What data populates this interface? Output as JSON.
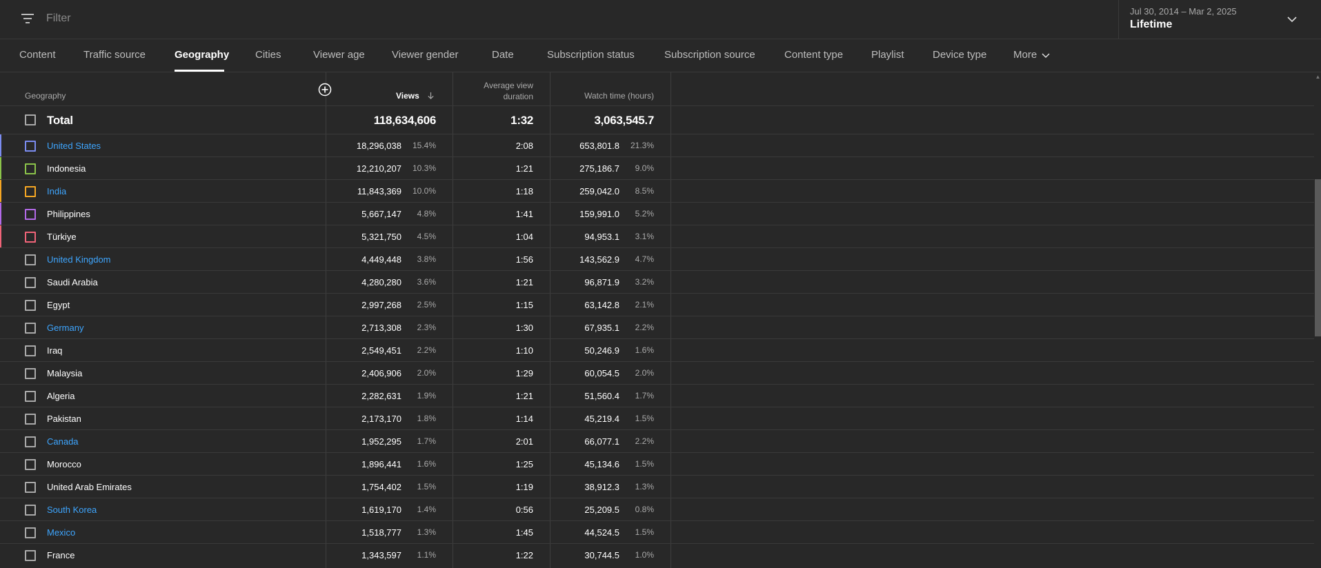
{
  "filter": {
    "placeholder": "Filter"
  },
  "date": {
    "range": "Jul 30, 2014 – Mar 2, 2025",
    "label": "Lifetime"
  },
  "tabs": [
    {
      "label": "Content"
    },
    {
      "label": "Traffic source"
    },
    {
      "label": "Geography"
    },
    {
      "label": "Cities"
    },
    {
      "label": "Viewer age"
    },
    {
      "label": "Viewer gender"
    },
    {
      "label": "Date"
    },
    {
      "label": "Subscription status"
    },
    {
      "label": "Subscription source"
    },
    {
      "label": "Content type"
    },
    {
      "label": "Playlist"
    },
    {
      "label": "Device type"
    },
    {
      "label": "More"
    }
  ],
  "active_tab": "Geography",
  "table": {
    "headers": {
      "geography": "Geography",
      "views": "Views",
      "avg_line1": "Average view",
      "avg_line2": "duration",
      "watch": "Watch time (hours)"
    },
    "sort": "descending by Views",
    "total": {
      "label": "Total",
      "views": "118,634,606",
      "avg": "1:32",
      "watch": "3,063,545.7"
    },
    "rows": [
      {
        "country": "United States",
        "link": true,
        "accent": "#7b8cf0",
        "views": "18,296,038",
        "views_pct": "15.4%",
        "avg": "2:08",
        "watch": "653,801.8",
        "watch_pct": "21.3%"
      },
      {
        "country": "Indonesia",
        "link": false,
        "accent": "#8bc34a",
        "views": "12,210,207",
        "views_pct": "10.3%",
        "avg": "1:21",
        "watch": "275,186.7",
        "watch_pct": "9.0%"
      },
      {
        "country": "India",
        "link": true,
        "accent": "#f5a623",
        "views": "11,843,369",
        "views_pct": "10.0%",
        "avg": "1:18",
        "watch": "259,042.0",
        "watch_pct": "8.5%"
      },
      {
        "country": "Philippines",
        "link": false,
        "accent": "#b36ae8",
        "views": "5,667,147",
        "views_pct": "4.8%",
        "avg": "1:41",
        "watch": "159,991.0",
        "watch_pct": "5.2%"
      },
      {
        "country": "Türkiye",
        "link": false,
        "accent": "#f06478",
        "views": "5,321,750",
        "views_pct": "4.5%",
        "avg": "1:04",
        "watch": "94,953.1",
        "watch_pct": "3.1%"
      },
      {
        "country": "United Kingdom",
        "link": true,
        "accent": "",
        "views": "4,449,448",
        "views_pct": "3.8%",
        "avg": "1:56",
        "watch": "143,562.9",
        "watch_pct": "4.7%"
      },
      {
        "country": "Saudi Arabia",
        "link": false,
        "accent": "",
        "views": "4,280,280",
        "views_pct": "3.6%",
        "avg": "1:21",
        "watch": "96,871.9",
        "watch_pct": "3.2%"
      },
      {
        "country": "Egypt",
        "link": false,
        "accent": "",
        "views": "2,997,268",
        "views_pct": "2.5%",
        "avg": "1:15",
        "watch": "63,142.8",
        "watch_pct": "2.1%"
      },
      {
        "country": "Germany",
        "link": true,
        "accent": "",
        "views": "2,713,308",
        "views_pct": "2.3%",
        "avg": "1:30",
        "watch": "67,935.1",
        "watch_pct": "2.2%"
      },
      {
        "country": "Iraq",
        "link": false,
        "accent": "",
        "views": "2,549,451",
        "views_pct": "2.2%",
        "avg": "1:10",
        "watch": "50,246.9",
        "watch_pct": "1.6%"
      },
      {
        "country": "Malaysia",
        "link": false,
        "accent": "",
        "views": "2,406,906",
        "views_pct": "2.0%",
        "avg": "1:29",
        "watch": "60,054.5",
        "watch_pct": "2.0%"
      },
      {
        "country": "Algeria",
        "link": false,
        "accent": "",
        "views": "2,282,631",
        "views_pct": "1.9%",
        "avg": "1:21",
        "watch": "51,560.4",
        "watch_pct": "1.7%"
      },
      {
        "country": "Pakistan",
        "link": false,
        "accent": "",
        "views": "2,173,170",
        "views_pct": "1.8%",
        "avg": "1:14",
        "watch": "45,219.4",
        "watch_pct": "1.5%"
      },
      {
        "country": "Canada",
        "link": true,
        "accent": "",
        "views": "1,952,295",
        "views_pct": "1.7%",
        "avg": "2:01",
        "watch": "66,077.1",
        "watch_pct": "2.2%"
      },
      {
        "country": "Morocco",
        "link": false,
        "accent": "",
        "views": "1,896,441",
        "views_pct": "1.6%",
        "avg": "1:25",
        "watch": "45,134.6",
        "watch_pct": "1.5%"
      },
      {
        "country": "United Arab Emirates",
        "link": false,
        "accent": "",
        "views": "1,754,402",
        "views_pct": "1.5%",
        "avg": "1:19",
        "watch": "38,912.3",
        "watch_pct": "1.3%"
      },
      {
        "country": "South Korea",
        "link": true,
        "accent": "",
        "views": "1,619,170",
        "views_pct": "1.4%",
        "avg": "0:56",
        "watch": "25,209.5",
        "watch_pct": "0.8%"
      },
      {
        "country": "Mexico",
        "link": true,
        "accent": "",
        "views": "1,518,777",
        "views_pct": "1.3%",
        "avg": "1:45",
        "watch": "44,524.5",
        "watch_pct": "1.5%"
      },
      {
        "country": "France",
        "link": false,
        "accent": "",
        "views": "1,343,597",
        "views_pct": "1.1%",
        "avg": "1:22",
        "watch": "30,744.5",
        "watch_pct": "1.0%"
      }
    ]
  },
  "colors": {
    "background": "#282828",
    "link": "#3ea6ff",
    "divider": "#3a3a3a"
  },
  "icons": [
    "filter-icon",
    "chevron-down-icon",
    "add-column-icon",
    "sort-arrow-down-icon",
    "checkbox-icon"
  ]
}
